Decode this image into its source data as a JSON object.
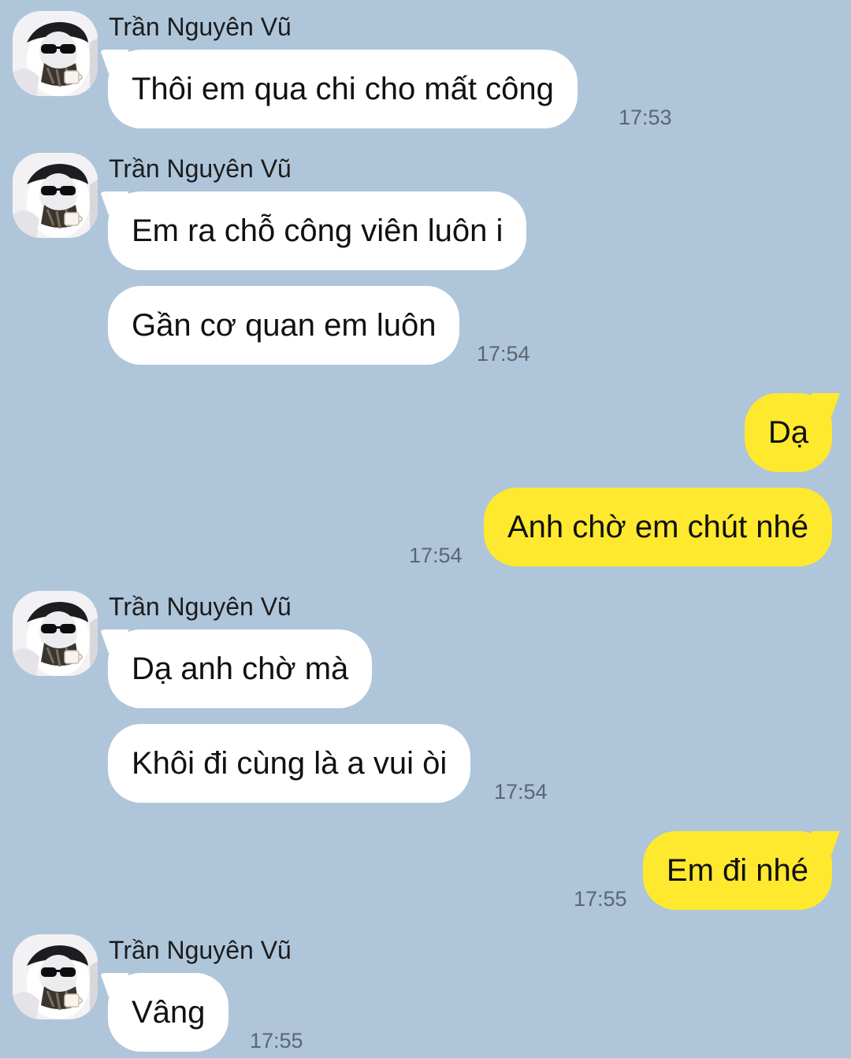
{
  "contact": {
    "name": "Trần Nguyên Vũ",
    "avatar_icon": "person-beret-sunglasses-avatar"
  },
  "colors": {
    "background": "#afc5da",
    "incoming_bubble": "#ffffff",
    "outgoing_bubble": "#fee92f",
    "timestamp": "#5b6673"
  },
  "messages": [
    {
      "sender": "Trần Nguyên Vũ",
      "text": "Thôi em qua chi cho mất công",
      "time": "17:53",
      "direction": "incoming"
    },
    {
      "sender": "Trần Nguyên Vũ",
      "text": "Em ra chỗ công viên luôn i",
      "direction": "incoming"
    },
    {
      "text": "Gần cơ quan em luôn",
      "time": "17:54",
      "direction": "incoming"
    },
    {
      "text": "Dạ",
      "direction": "outgoing"
    },
    {
      "text": "Anh chờ em chút nhé",
      "time": "17:54",
      "direction": "outgoing"
    },
    {
      "sender": "Trần Nguyên Vũ",
      "text": "Dạ anh chờ mà",
      "direction": "incoming"
    },
    {
      "text": "Khôi đi cùng là a vui òi",
      "time": "17:54",
      "direction": "incoming"
    },
    {
      "text": "Em đi nhé",
      "time": "17:55",
      "direction": "outgoing"
    },
    {
      "sender": "Trần Nguyên Vũ",
      "text": "Vâng",
      "time": "17:55",
      "direction": "incoming"
    }
  ]
}
